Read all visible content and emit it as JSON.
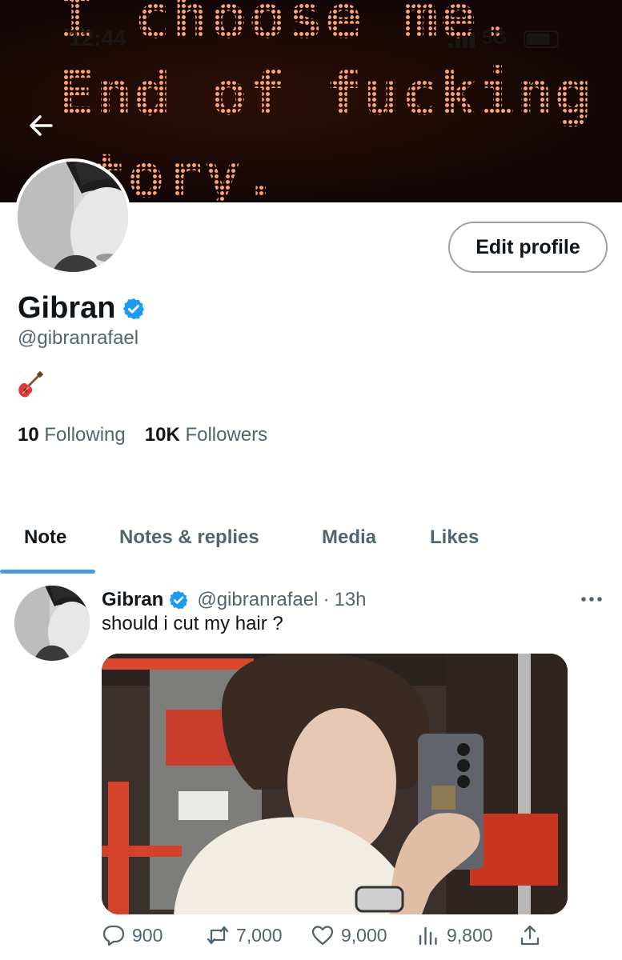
{
  "banner": {
    "lines": [
      "I choose me.",
      "End of fucking",
      "story."
    ]
  },
  "status_bar": {
    "time": "12:44",
    "network": "5G",
    "battery_level": 0.8
  },
  "profile": {
    "name": "Gibran",
    "handle": "@gibranrafael",
    "bio_emoji": "guitar-emoji",
    "edit_label": "Edit profile",
    "following_count": "10",
    "following_label": "Following",
    "followers_count": "10K",
    "followers_label": "Followers",
    "verified_color": "#1d9bf0"
  },
  "tabs": [
    {
      "label": "Note",
      "active": true
    },
    {
      "label": "Notes & replies",
      "active": false
    },
    {
      "label": "Media",
      "active": false
    },
    {
      "label": "Likes",
      "active": false
    }
  ],
  "post": {
    "name": "Gibran",
    "handle": "@gibranrafael",
    "separator": "·",
    "time": "13h",
    "text": "should i cut my hair ?",
    "replies": "900",
    "reposts": "7,000",
    "likes": "9,000",
    "views": "9,800"
  },
  "colors": {
    "accent": "#4a9bd8",
    "secondary_text": "#536471",
    "primary_text": "#0f1419"
  }
}
